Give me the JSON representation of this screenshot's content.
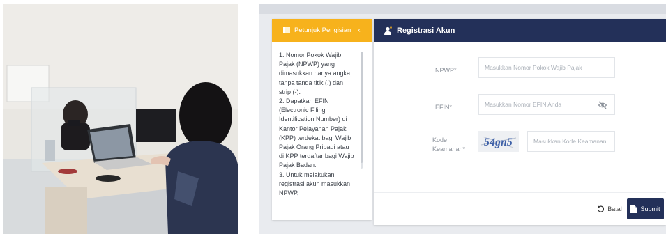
{
  "guide": {
    "title": "Petunjuk Pengisian",
    "items": [
      "1. Nomor Pokok Wajib Pajak (NPWP) yang dimasukkan hanya angka, tanpa tanda titik (.) dan strip (-).",
      "2. Dapatkan EFIN (Electronic Filing Identification Number) di Kantor Pelayanan Pajak (KPP) terdekat bagi Wajib Pajak Orang Pribadi atau di KPP terdaftar bagi Wajib Pajak Badan.",
      "3. Untuk melakukan registrasi akun masukkan NPWP,"
    ]
  },
  "form": {
    "title": "Registrasi Akun",
    "npwp_label": "NPWP*",
    "npwp_placeholder": "Masukkan Nomor Pokok Wajib Pajak",
    "efin_label": "EFIN*",
    "efin_placeholder": "Masukkan Nomor EFIN Anda",
    "kode_label_1": "Kode",
    "kode_label_2": "Keamanan*",
    "captcha_text": "54gn5",
    "kode_placeholder": "Masukkan Kode Keamanan",
    "batal_label": "Batal",
    "submit_label": "Submit"
  },
  "colors": {
    "accent": "#f7b21c",
    "header": "#233059"
  }
}
